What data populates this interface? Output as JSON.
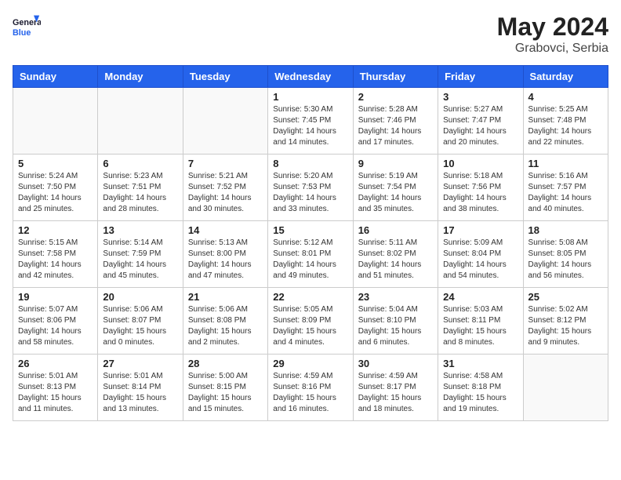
{
  "header": {
    "logo_line1": "General",
    "logo_line2": "Blue",
    "month_year": "May 2024",
    "location": "Grabovci, Serbia"
  },
  "weekdays": [
    "Sunday",
    "Monday",
    "Tuesday",
    "Wednesday",
    "Thursday",
    "Friday",
    "Saturday"
  ],
  "weeks": [
    [
      {
        "day": "",
        "info": ""
      },
      {
        "day": "",
        "info": ""
      },
      {
        "day": "",
        "info": ""
      },
      {
        "day": "1",
        "info": "Sunrise: 5:30 AM\nSunset: 7:45 PM\nDaylight: 14 hours\nand 14 minutes."
      },
      {
        "day": "2",
        "info": "Sunrise: 5:28 AM\nSunset: 7:46 PM\nDaylight: 14 hours\nand 17 minutes."
      },
      {
        "day": "3",
        "info": "Sunrise: 5:27 AM\nSunset: 7:47 PM\nDaylight: 14 hours\nand 20 minutes."
      },
      {
        "day": "4",
        "info": "Sunrise: 5:25 AM\nSunset: 7:48 PM\nDaylight: 14 hours\nand 22 minutes."
      }
    ],
    [
      {
        "day": "5",
        "info": "Sunrise: 5:24 AM\nSunset: 7:50 PM\nDaylight: 14 hours\nand 25 minutes."
      },
      {
        "day": "6",
        "info": "Sunrise: 5:23 AM\nSunset: 7:51 PM\nDaylight: 14 hours\nand 28 minutes."
      },
      {
        "day": "7",
        "info": "Sunrise: 5:21 AM\nSunset: 7:52 PM\nDaylight: 14 hours\nand 30 minutes."
      },
      {
        "day": "8",
        "info": "Sunrise: 5:20 AM\nSunset: 7:53 PM\nDaylight: 14 hours\nand 33 minutes."
      },
      {
        "day": "9",
        "info": "Sunrise: 5:19 AM\nSunset: 7:54 PM\nDaylight: 14 hours\nand 35 minutes."
      },
      {
        "day": "10",
        "info": "Sunrise: 5:18 AM\nSunset: 7:56 PM\nDaylight: 14 hours\nand 38 minutes."
      },
      {
        "day": "11",
        "info": "Sunrise: 5:16 AM\nSunset: 7:57 PM\nDaylight: 14 hours\nand 40 minutes."
      }
    ],
    [
      {
        "day": "12",
        "info": "Sunrise: 5:15 AM\nSunset: 7:58 PM\nDaylight: 14 hours\nand 42 minutes."
      },
      {
        "day": "13",
        "info": "Sunrise: 5:14 AM\nSunset: 7:59 PM\nDaylight: 14 hours\nand 45 minutes."
      },
      {
        "day": "14",
        "info": "Sunrise: 5:13 AM\nSunset: 8:00 PM\nDaylight: 14 hours\nand 47 minutes."
      },
      {
        "day": "15",
        "info": "Sunrise: 5:12 AM\nSunset: 8:01 PM\nDaylight: 14 hours\nand 49 minutes."
      },
      {
        "day": "16",
        "info": "Sunrise: 5:11 AM\nSunset: 8:02 PM\nDaylight: 14 hours\nand 51 minutes."
      },
      {
        "day": "17",
        "info": "Sunrise: 5:09 AM\nSunset: 8:04 PM\nDaylight: 14 hours\nand 54 minutes."
      },
      {
        "day": "18",
        "info": "Sunrise: 5:08 AM\nSunset: 8:05 PM\nDaylight: 14 hours\nand 56 minutes."
      }
    ],
    [
      {
        "day": "19",
        "info": "Sunrise: 5:07 AM\nSunset: 8:06 PM\nDaylight: 14 hours\nand 58 minutes."
      },
      {
        "day": "20",
        "info": "Sunrise: 5:06 AM\nSunset: 8:07 PM\nDaylight: 15 hours\nand 0 minutes."
      },
      {
        "day": "21",
        "info": "Sunrise: 5:06 AM\nSunset: 8:08 PM\nDaylight: 15 hours\nand 2 minutes."
      },
      {
        "day": "22",
        "info": "Sunrise: 5:05 AM\nSunset: 8:09 PM\nDaylight: 15 hours\nand 4 minutes."
      },
      {
        "day": "23",
        "info": "Sunrise: 5:04 AM\nSunset: 8:10 PM\nDaylight: 15 hours\nand 6 minutes."
      },
      {
        "day": "24",
        "info": "Sunrise: 5:03 AM\nSunset: 8:11 PM\nDaylight: 15 hours\nand 8 minutes."
      },
      {
        "day": "25",
        "info": "Sunrise: 5:02 AM\nSunset: 8:12 PM\nDaylight: 15 hours\nand 9 minutes."
      }
    ],
    [
      {
        "day": "26",
        "info": "Sunrise: 5:01 AM\nSunset: 8:13 PM\nDaylight: 15 hours\nand 11 minutes."
      },
      {
        "day": "27",
        "info": "Sunrise: 5:01 AM\nSunset: 8:14 PM\nDaylight: 15 hours\nand 13 minutes."
      },
      {
        "day": "28",
        "info": "Sunrise: 5:00 AM\nSunset: 8:15 PM\nDaylight: 15 hours\nand 15 minutes."
      },
      {
        "day": "29",
        "info": "Sunrise: 4:59 AM\nSunset: 8:16 PM\nDaylight: 15 hours\nand 16 minutes."
      },
      {
        "day": "30",
        "info": "Sunrise: 4:59 AM\nSunset: 8:17 PM\nDaylight: 15 hours\nand 18 minutes."
      },
      {
        "day": "31",
        "info": "Sunrise: 4:58 AM\nSunset: 8:18 PM\nDaylight: 15 hours\nand 19 minutes."
      },
      {
        "day": "",
        "info": ""
      }
    ]
  ]
}
